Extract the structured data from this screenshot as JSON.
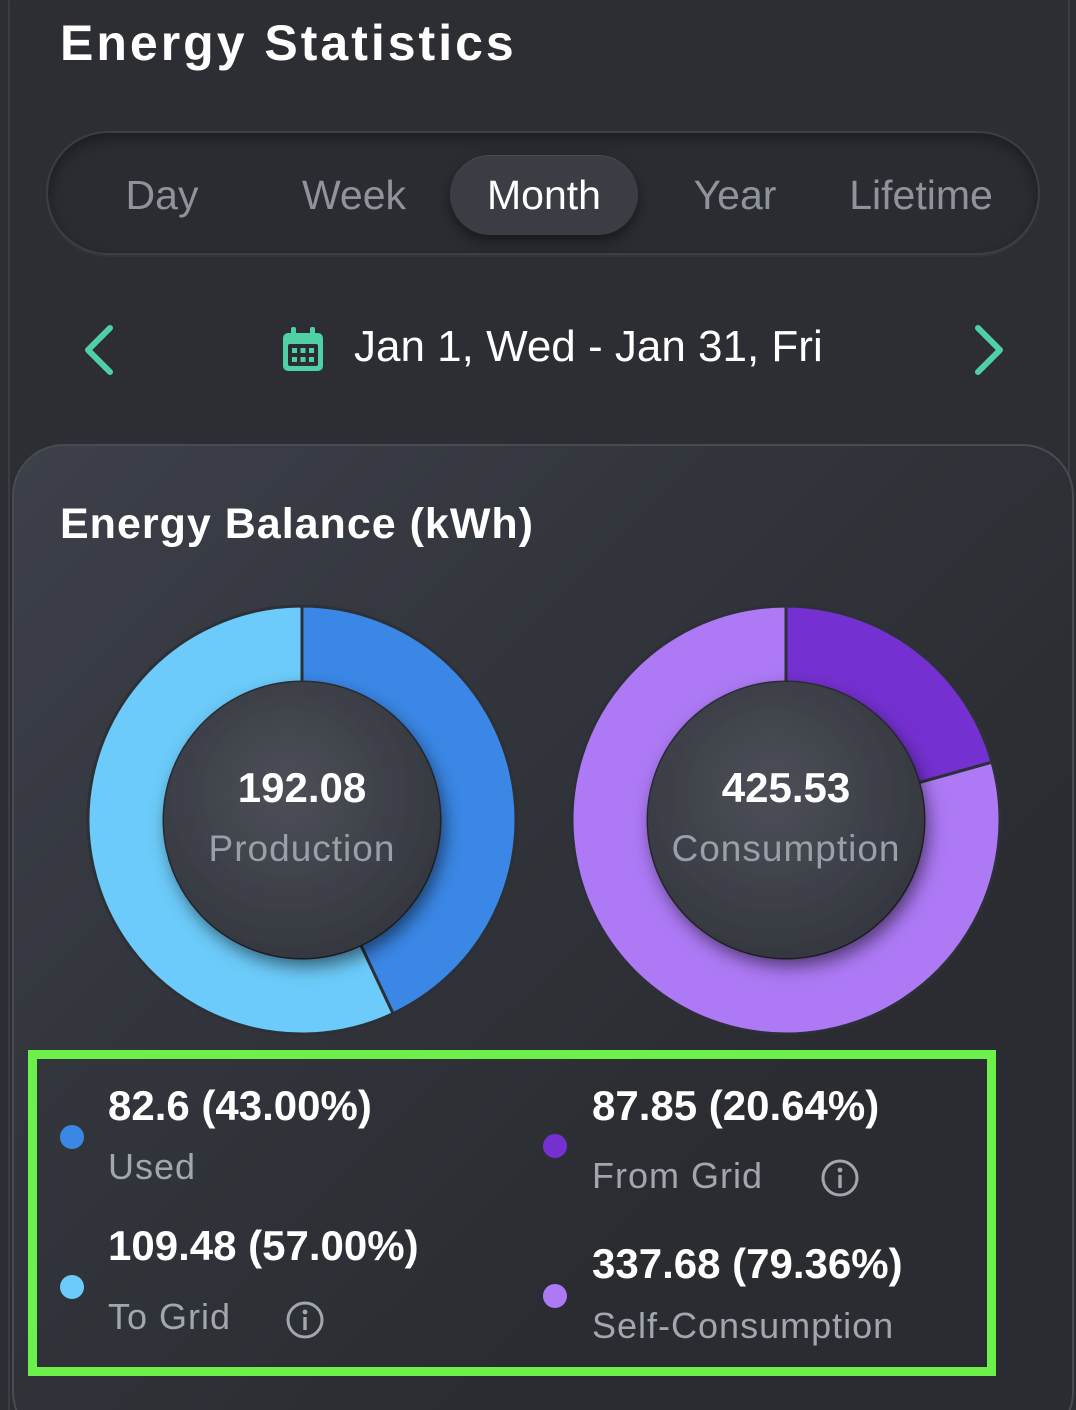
{
  "header": {
    "title": "Energy Statistics"
  },
  "tabs": [
    {
      "label": "Day",
      "active": false
    },
    {
      "label": "Week",
      "active": false
    },
    {
      "label": "Month",
      "active": true
    },
    {
      "label": "Year",
      "active": false
    },
    {
      "label": "Lifetime",
      "active": false
    }
  ],
  "date_nav": {
    "range": "Jan 1, Wed - Jan 31, Fri",
    "prev_icon": "chevron-left-icon",
    "next_icon": "chevron-right-icon",
    "calendar_icon": "calendar-icon"
  },
  "balance": {
    "title": "Energy Balance (kWh)",
    "production": {
      "value": "192.08",
      "label": "Production"
    },
    "consumption": {
      "value": "425.53",
      "label": "Consumption"
    }
  },
  "legend": {
    "used": {
      "value": "82.6 (43.00%)",
      "label": "Used",
      "color": "#3a87e6"
    },
    "to_grid": {
      "value": "109.48 (57.00%)",
      "label": "To Grid",
      "color": "#6ccbfa"
    },
    "from_grid": {
      "value": "87.85 (20.64%)",
      "label": "From Grid",
      "color": "#7430d0"
    },
    "self_consumption": {
      "value": "337.68 (79.36%)",
      "label": "Self-Consumption",
      "color": "#ad79f5"
    }
  },
  "chart_data": [
    {
      "type": "pie",
      "center_value": "192.08",
      "center_label": "Production",
      "categories": [
        "Used",
        "To Grid"
      ],
      "values": [
        82.6,
        109.48
      ],
      "percent": [
        43.0,
        57.0
      ],
      "colors": [
        "#3a87e6",
        "#6ccbfa"
      ]
    },
    {
      "type": "pie",
      "center_value": "425.53",
      "center_label": "Consumption",
      "categories": [
        "From Grid",
        "Self-Consumption"
      ],
      "values": [
        87.85,
        337.68
      ],
      "percent": [
        20.64,
        79.36
      ],
      "colors": [
        "#7430d0",
        "#ad79f5"
      ]
    }
  ]
}
